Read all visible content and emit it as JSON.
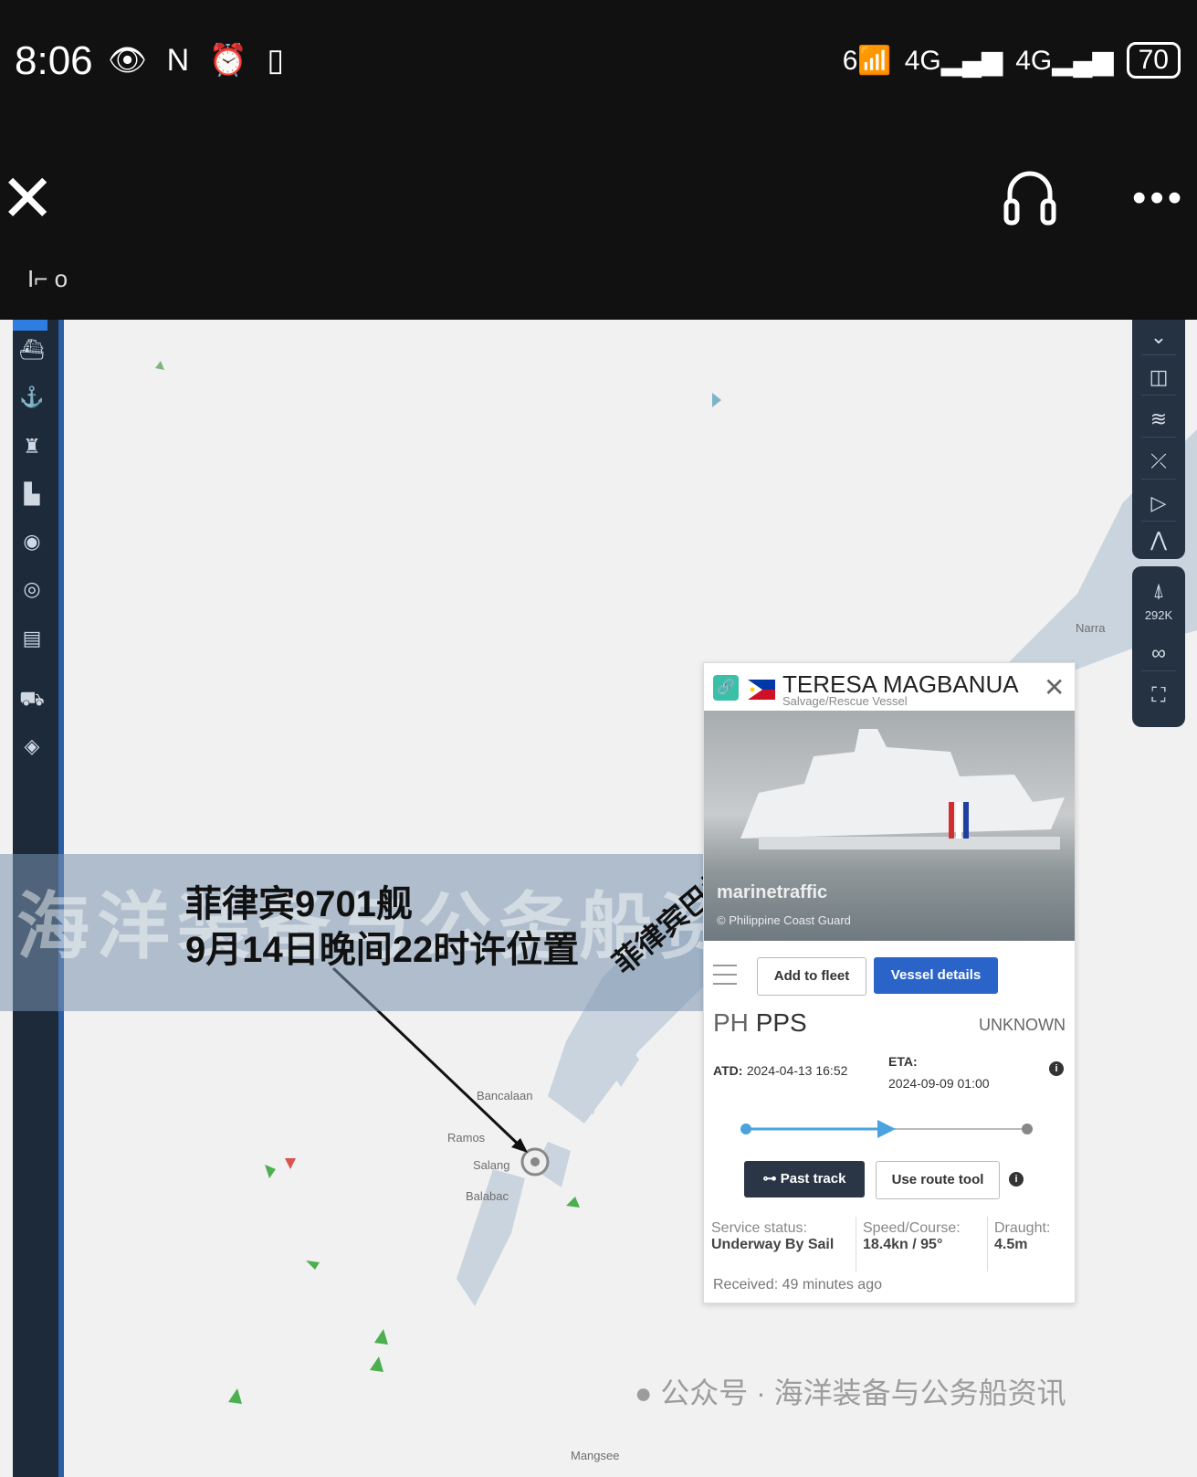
{
  "status_bar": {
    "time": "8:06",
    "left_icons": "👁 N ⏰ ▯",
    "wifi": "6",
    "sim1": "4G",
    "sim2": "4G",
    "battery": "70"
  },
  "app_bar": {
    "close_icon": "close-icon",
    "audio_icon": "headphones-icon",
    "more_icon": "more-icon",
    "sub_icons": "I⌐ o"
  },
  "map": {
    "left_toolbar": [
      "vessel-icon",
      "anchor-icon",
      "lighthouse-icon",
      "building-icon",
      "signal-icon",
      "target-icon",
      "table-icon",
      "ship-icon",
      "cube-icon"
    ],
    "right_toolbar": [
      "chevron-icon",
      "layers-icon",
      "weather-icon",
      "measure-icon",
      "play-icon",
      "navigation-icon"
    ],
    "right_toolbar_2": {
      "zoom_label": "292K"
    },
    "place_names": {
      "narra": "Narra",
      "bancalaan": "Bancalaan",
      "ramos": "Ramos",
      "salang": "Salang",
      "balabac": "Balabac",
      "mangsee": "Mangsee"
    }
  },
  "watermark": "海洋装备与公务船资讯",
  "annotation": {
    "line1": "菲律宾9701舰",
    "line2": "9月14日晚间22时许位置"
  },
  "island_label": "菲律宾巴拉望岛",
  "vessel_card": {
    "name": "TERESA MAGBANUA",
    "type": "Salvage/Rescue Vessel",
    "photo_brand": "marinetraffic",
    "photo_credit": "© Philippine Coast Guard",
    "add_to_fleet": "Add to fleet",
    "vessel_details": "Vessel details",
    "flag_code": "PH",
    "from_port": "PPS",
    "destination": "UNKNOWN",
    "atd_label": "ATD:",
    "atd_value": "2024-04-13 16:52",
    "eta_label": "ETA:",
    "eta_value": "2024-09-09 01:00",
    "past_track": "Past track",
    "route_tool": "Use route tool",
    "service_status_label": "Service status:",
    "service_status_value": "Underway By Sail",
    "speed_course_label": "Speed/Course:",
    "speed_course_value": "18.4kn / 95°",
    "draught_label": "Draught:",
    "draught_value": "4.5m",
    "received": "Received: 49 minutes ago",
    "progress_fraction": 0.5
  },
  "bottom_watermark": "公众号 · 海洋装备与公务船资讯",
  "colors": {
    "accent": "#2a64c8",
    "toolbar": "#1d2a3a",
    "teal": "#3bc0a8"
  }
}
